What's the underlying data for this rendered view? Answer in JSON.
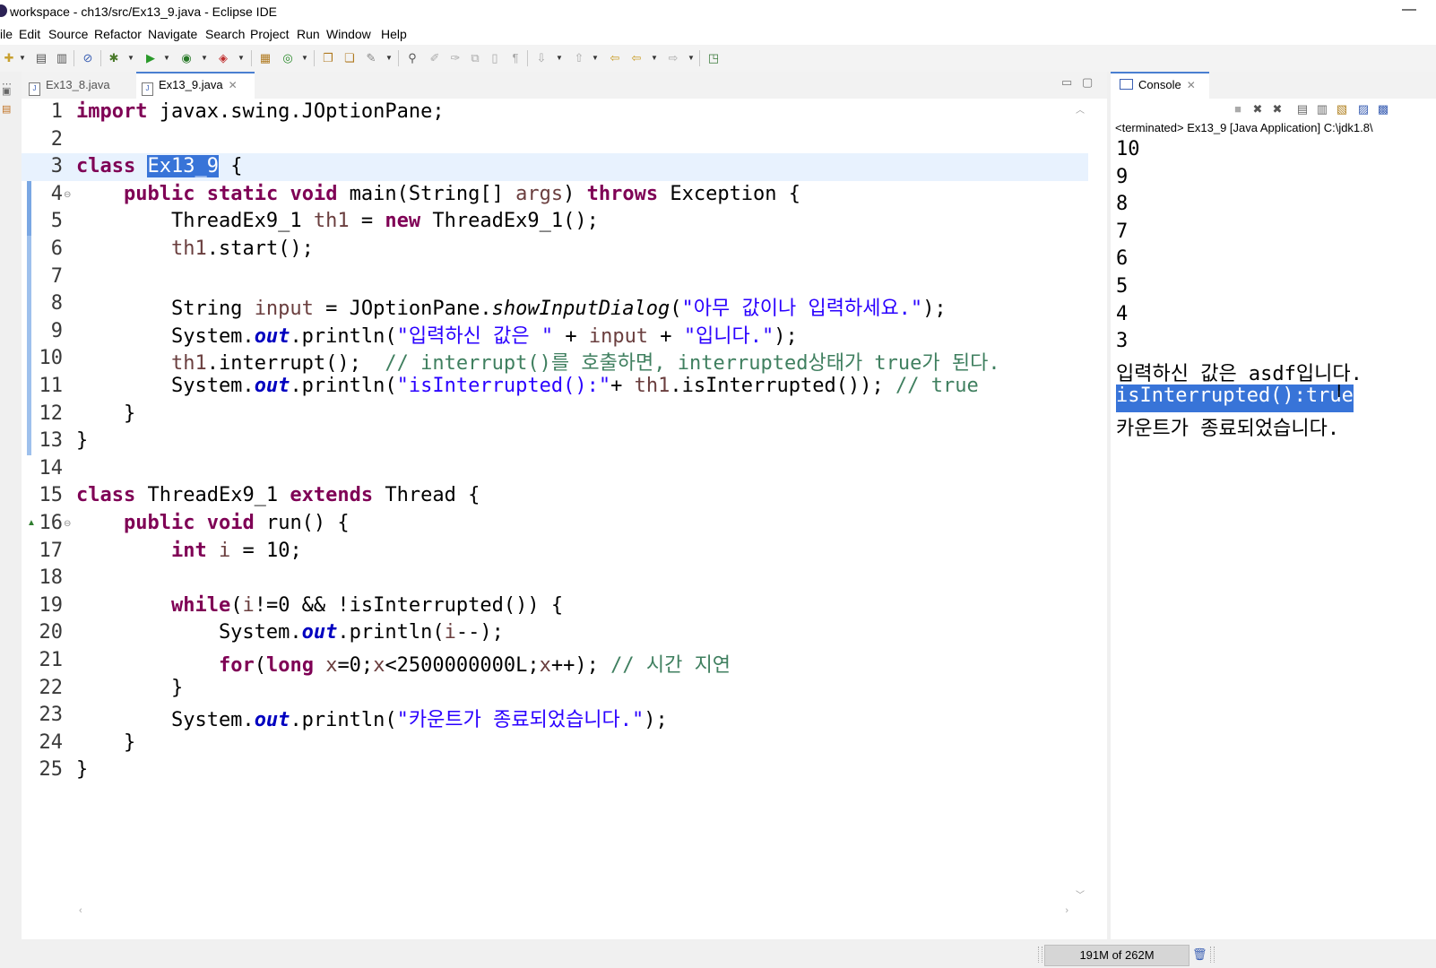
{
  "window": {
    "title": "workspace - ch13/src/Ex13_9.java - Eclipse IDE"
  },
  "menu": [
    "ile",
    "Edit",
    "Source",
    "Refactor",
    "Navigate",
    "Search",
    "Project",
    "Run",
    "Window",
    "Help"
  ],
  "toolbar_icons": [
    "new-icon",
    "save-icon",
    "save-all-icon",
    "skip-breakpoints-icon",
    "debug-icon",
    "run-icon",
    "coverage-icon",
    "external-tools-icon",
    "new-package-icon",
    "new-class-icon",
    "open-type-icon",
    "open-task-icon",
    "search-icon",
    "annotation-icon",
    "next-annotation-icon",
    "toggle-mark-icon",
    "show-whitespace-icon",
    "back-icon",
    "forward-icon",
    "perspective-icon"
  ],
  "editor": {
    "tabs": [
      {
        "label": "Ex13_8.java",
        "active": false
      },
      {
        "label": "Ex13_9.java",
        "active": true
      }
    ],
    "current_line": 3,
    "lines": [
      [
        [
          "kw",
          "import"
        ],
        [
          "n",
          " javax.swing.JOptionPane;"
        ]
      ],
      [],
      [
        [
          "kw",
          "class"
        ],
        [
          "n",
          " "
        ],
        [
          "sel",
          "Ex13_9"
        ],
        [
          "n",
          " {"
        ]
      ],
      [
        [
          "n",
          "    "
        ],
        [
          "kw",
          "public"
        ],
        [
          "n",
          " "
        ],
        [
          "kw",
          "static"
        ],
        [
          "n",
          " "
        ],
        [
          "kw",
          "void"
        ],
        [
          "n",
          " main(String[] "
        ],
        [
          "var",
          "args"
        ],
        [
          "n",
          ") "
        ],
        [
          "kw",
          "throws"
        ],
        [
          "n",
          " Exception {"
        ]
      ],
      [
        [
          "n",
          "        ThreadEx9_1 "
        ],
        [
          "var",
          "th1"
        ],
        [
          "n",
          " = "
        ],
        [
          "kw",
          "new"
        ],
        [
          "n",
          " ThreadEx9_1();"
        ]
      ],
      [
        [
          "n",
          "        "
        ],
        [
          "var",
          "th1"
        ],
        [
          "n",
          ".start();"
        ]
      ],
      [],
      [
        [
          "n",
          "        String "
        ],
        [
          "var",
          "input"
        ],
        [
          "n",
          " = JOptionPane."
        ],
        [
          "it",
          "showInputDialog"
        ],
        [
          "n",
          "("
        ],
        [
          "str",
          "\"아무 값이나 입력하세요.\""
        ],
        [
          "n",
          ");"
        ]
      ],
      [
        [
          "n",
          "        System."
        ],
        [
          "fld",
          "out"
        ],
        [
          "n",
          ".println("
        ],
        [
          "str",
          "\"입력하신 값은 \""
        ],
        [
          "n",
          " + "
        ],
        [
          "var",
          "input"
        ],
        [
          "n",
          " + "
        ],
        [
          "str",
          "\"입니다.\""
        ],
        [
          "n",
          ");"
        ]
      ],
      [
        [
          "n",
          "        "
        ],
        [
          "var",
          "th1"
        ],
        [
          "n",
          ".interrupt();  "
        ],
        [
          "cmt",
          "// interrupt()를 호출하면, interrupted상태가 true가 된다."
        ]
      ],
      [
        [
          "n",
          "        System."
        ],
        [
          "fld",
          "out"
        ],
        [
          "n",
          ".println("
        ],
        [
          "str",
          "\"isInterrupted():\""
        ],
        [
          "n",
          "+ "
        ],
        [
          "var",
          "th1"
        ],
        [
          "n",
          ".isInterrupted()); "
        ],
        [
          "cmt",
          "// true"
        ]
      ],
      [
        [
          "n",
          "    }"
        ]
      ],
      [
        [
          "n",
          "}"
        ]
      ],
      [],
      [
        [
          "kw",
          "class"
        ],
        [
          "n",
          " ThreadEx9_1 "
        ],
        [
          "kw",
          "extends"
        ],
        [
          "n",
          " Thread {"
        ]
      ],
      [
        [
          "n",
          "    "
        ],
        [
          "kw",
          "public"
        ],
        [
          "n",
          " "
        ],
        [
          "kw",
          "void"
        ],
        [
          "n",
          " run() {"
        ]
      ],
      [
        [
          "n",
          "        "
        ],
        [
          "kw",
          "int"
        ],
        [
          "n",
          " "
        ],
        [
          "var",
          "i"
        ],
        [
          "n",
          " = 10;"
        ]
      ],
      [],
      [
        [
          "n",
          "        "
        ],
        [
          "kw",
          "while"
        ],
        [
          "n",
          "("
        ],
        [
          "var",
          "i"
        ],
        [
          "n",
          "!=0 && !isInterrupted()) {"
        ]
      ],
      [
        [
          "n",
          "            System."
        ],
        [
          "fld",
          "out"
        ],
        [
          "n",
          ".println("
        ],
        [
          "var",
          "i"
        ],
        [
          "n",
          "--);"
        ]
      ],
      [
        [
          "n",
          "            "
        ],
        [
          "kw",
          "for"
        ],
        [
          "n",
          "("
        ],
        [
          "kw",
          "long"
        ],
        [
          "n",
          " "
        ],
        [
          "var",
          "x"
        ],
        [
          "n",
          "=0;"
        ],
        [
          "var",
          "x"
        ],
        [
          "n",
          "<2500000000L;"
        ],
        [
          "var",
          "x"
        ],
        [
          "n",
          "++); "
        ],
        [
          "cmt",
          "// 시간 지연"
        ]
      ],
      [
        [
          "n",
          "        }"
        ]
      ],
      [
        [
          "n",
          "        System."
        ],
        [
          "fld",
          "out"
        ],
        [
          "n",
          ".println("
        ],
        [
          "str",
          "\"카운트가 종료되었습니다.\""
        ],
        [
          "n",
          ");"
        ]
      ],
      [
        [
          "n",
          "    }"
        ]
      ],
      [
        [
          "n",
          "}"
        ]
      ]
    ]
  },
  "console": {
    "tab_label": "Console",
    "status": "<terminated> Ex13_9 [Java Application] C:\\jdk1.8\\",
    "output": [
      "10",
      "9",
      "8",
      "7",
      "6",
      "5",
      "4",
      "3",
      "입력하신 값은 asdf입니다.",
      "isInterrupted():true",
      "카운트가 종료되었습니다."
    ],
    "selected_output_line": 10
  },
  "statusbar": {
    "heap": "191M of 262M"
  }
}
